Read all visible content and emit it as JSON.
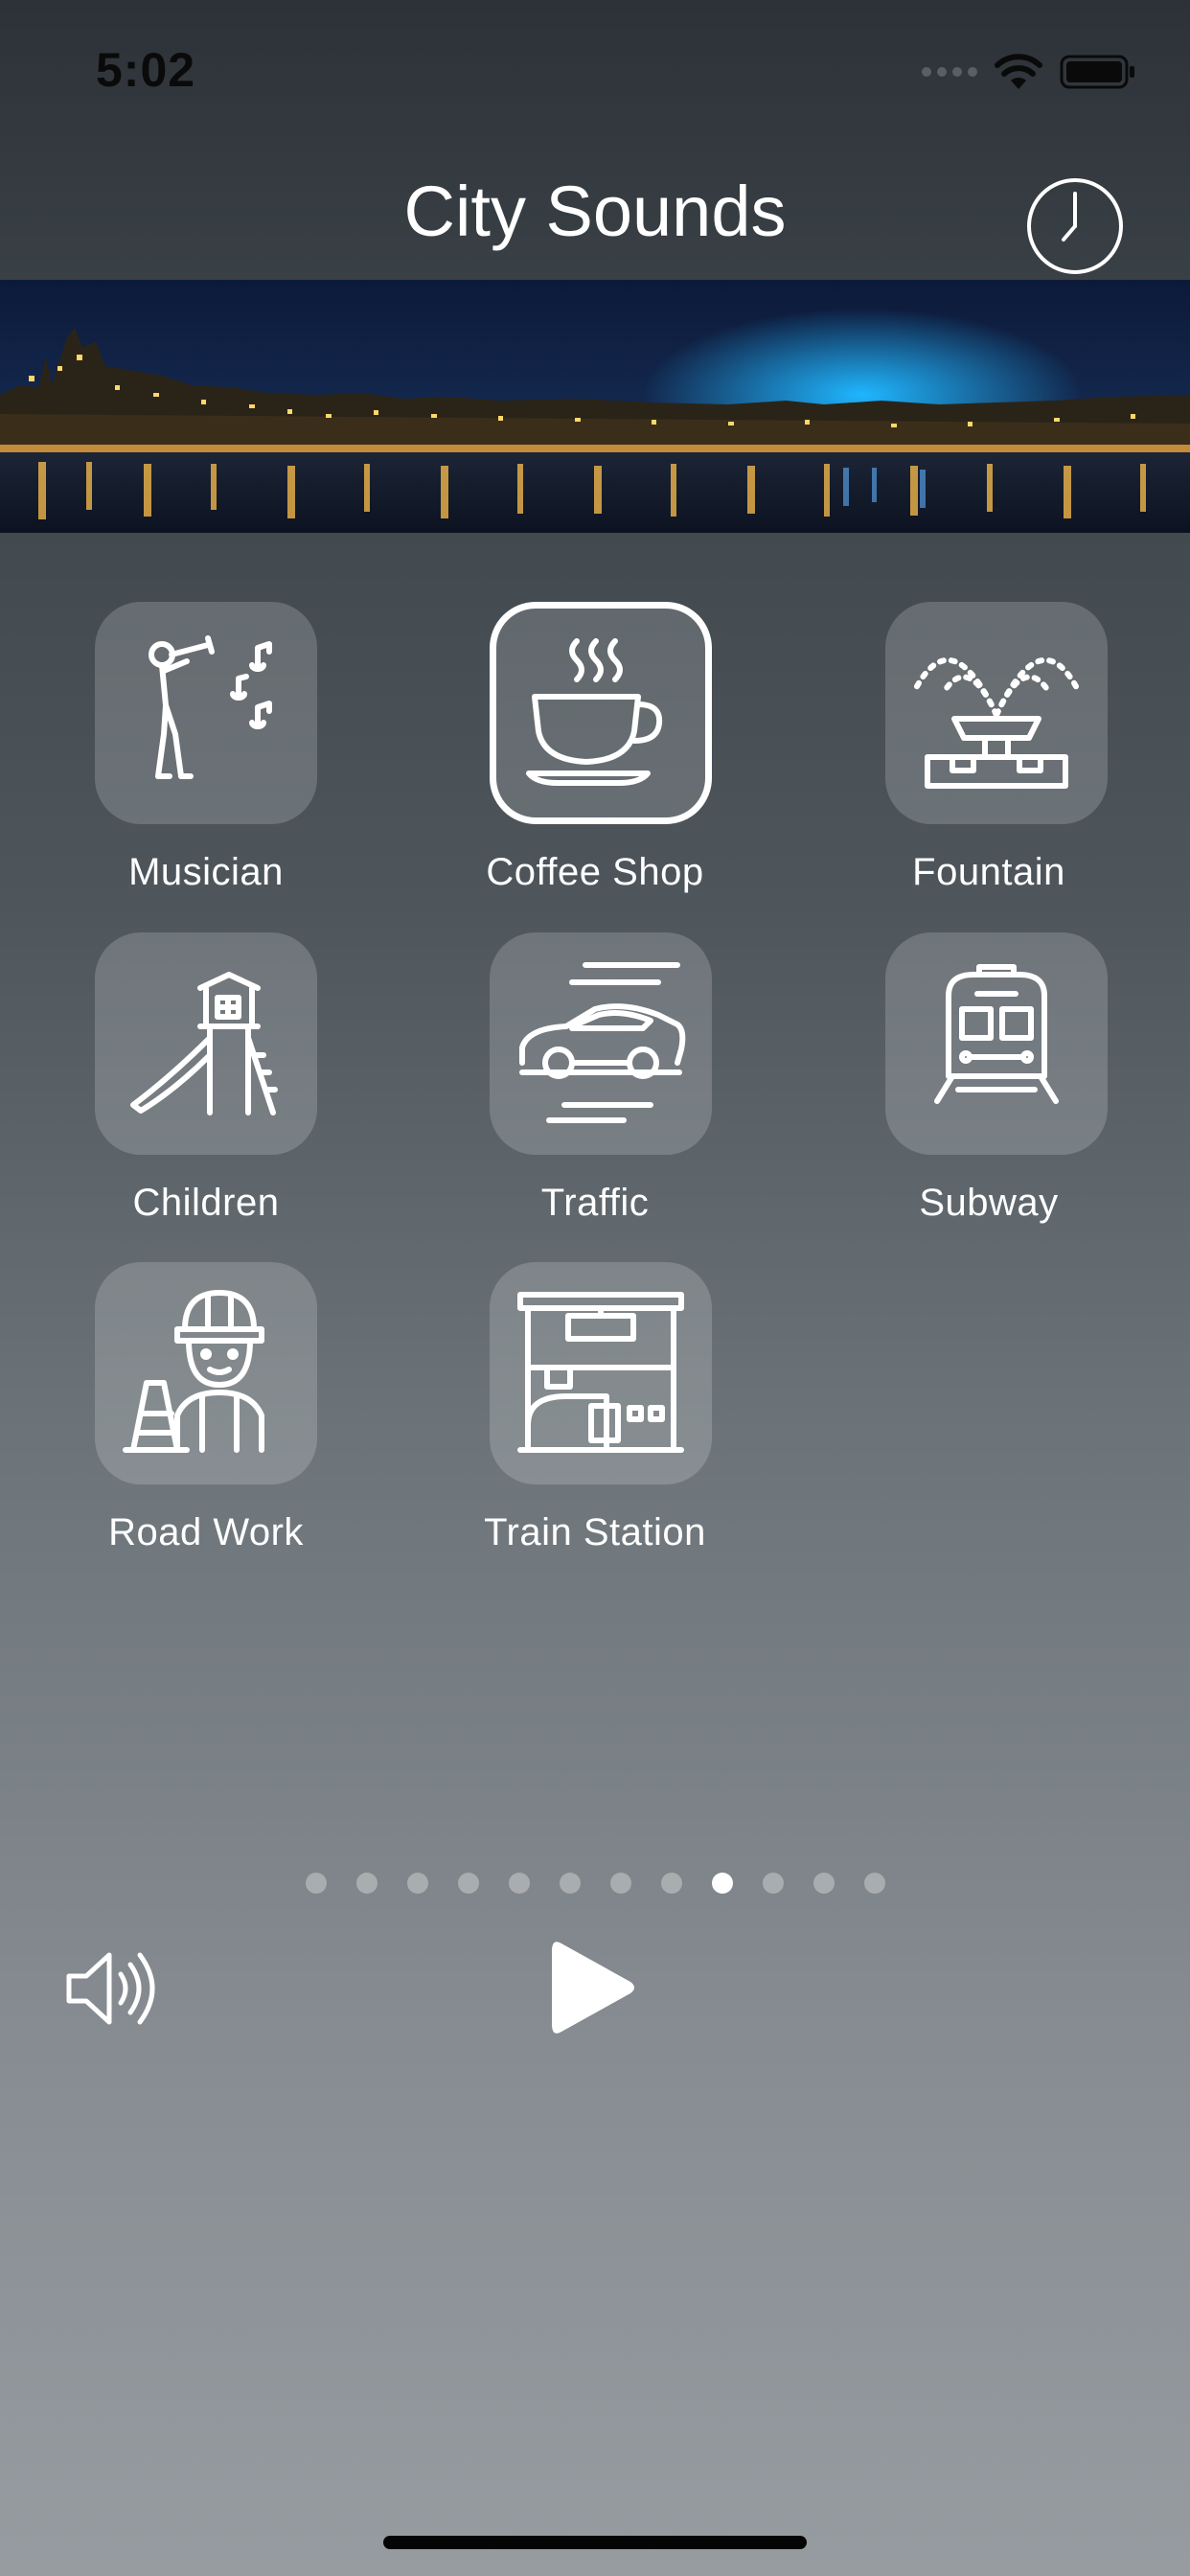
{
  "status_bar": {
    "time": "5:02",
    "icons": [
      "cellular-signal-icon",
      "wifi-icon",
      "battery-icon"
    ]
  },
  "header": {
    "title": "City Sounds",
    "history_icon": "clock-icon"
  },
  "banner": {
    "image": "night-city-river-panorama"
  },
  "sounds": [
    {
      "label": "Musician",
      "icon": "trumpet-player-icon",
      "selected": false
    },
    {
      "label": "Coffee Shop",
      "icon": "coffee-cup-icon",
      "selected": true
    },
    {
      "label": "Fountain",
      "icon": "fountain-icon",
      "selected": false
    },
    {
      "label": "Children",
      "icon": "playground-slide-icon",
      "selected": false
    },
    {
      "label": "Traffic",
      "icon": "car-icon",
      "selected": false
    },
    {
      "label": "Subway",
      "icon": "subway-train-icon",
      "selected": false
    },
    {
      "label": "Road Work",
      "icon": "construction-worker-icon",
      "selected": false
    },
    {
      "label": "Train Station",
      "icon": "train-station-icon",
      "selected": false
    }
  ],
  "pagination": {
    "total": 12,
    "current": 9
  },
  "controls": {
    "volume_icon": "speaker-icon",
    "play_icon": "play-icon"
  },
  "colors": {
    "background_top": "#2c3237",
    "background_bottom": "#969ca0",
    "tile": "rgba(255,255,255,0.18)",
    "text": "#ffffff"
  }
}
